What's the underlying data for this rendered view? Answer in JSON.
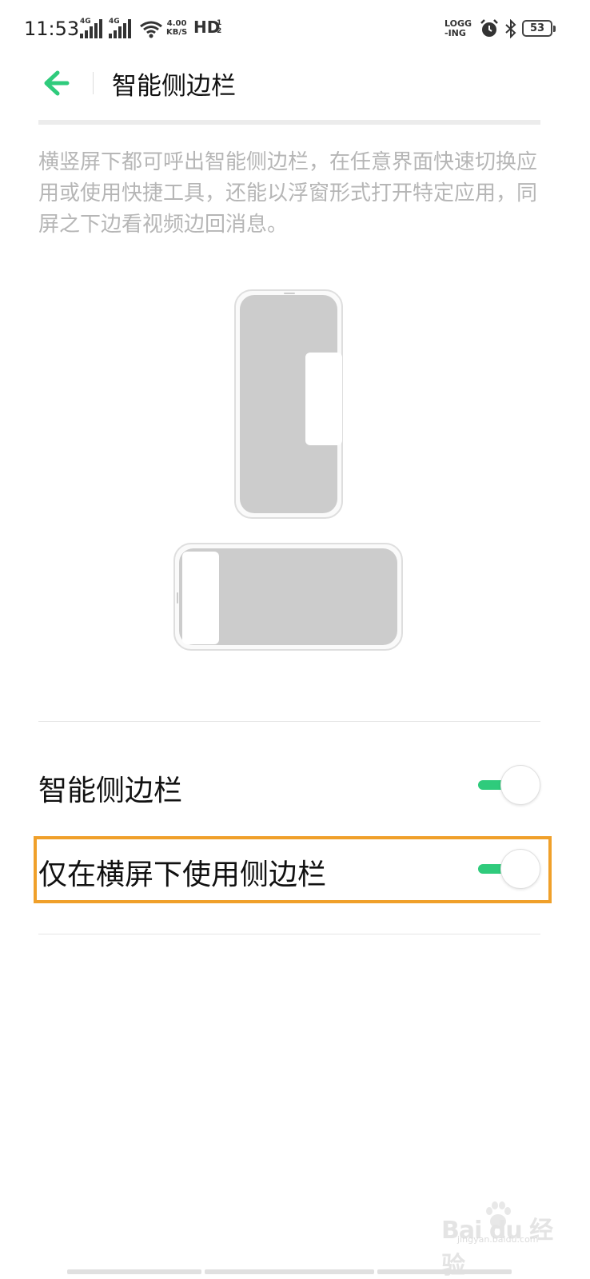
{
  "status_bar": {
    "time": "11:53",
    "network1": "4G",
    "network2": "4G",
    "speed_value": "4.00",
    "speed_unit": "KB/S",
    "hd": "HD",
    "hd_sub1": "1",
    "hd_sub2": "2",
    "logging_line1": "LOGG",
    "logging_line2": "-ING",
    "battery": "53"
  },
  "header": {
    "title": "智能侧边栏"
  },
  "description": "横竖屏下都可呼出智能侧边栏，在任意界面快速切换应用或使用快捷工具，还能以浮窗形式打开特定应用，同屏之下边看视频边回消息。",
  "settings": [
    {
      "label": "智能侧边栏",
      "enabled": true
    },
    {
      "label": "仅在横屏下使用侧边栏",
      "enabled": true
    }
  ],
  "colors": {
    "accent": "#2fcb7c",
    "highlight": "#f0a02a",
    "description_text": "#b6b6b6"
  },
  "watermark": {
    "text": "Bai du 经验",
    "url": "jingyan.baidu.com"
  }
}
